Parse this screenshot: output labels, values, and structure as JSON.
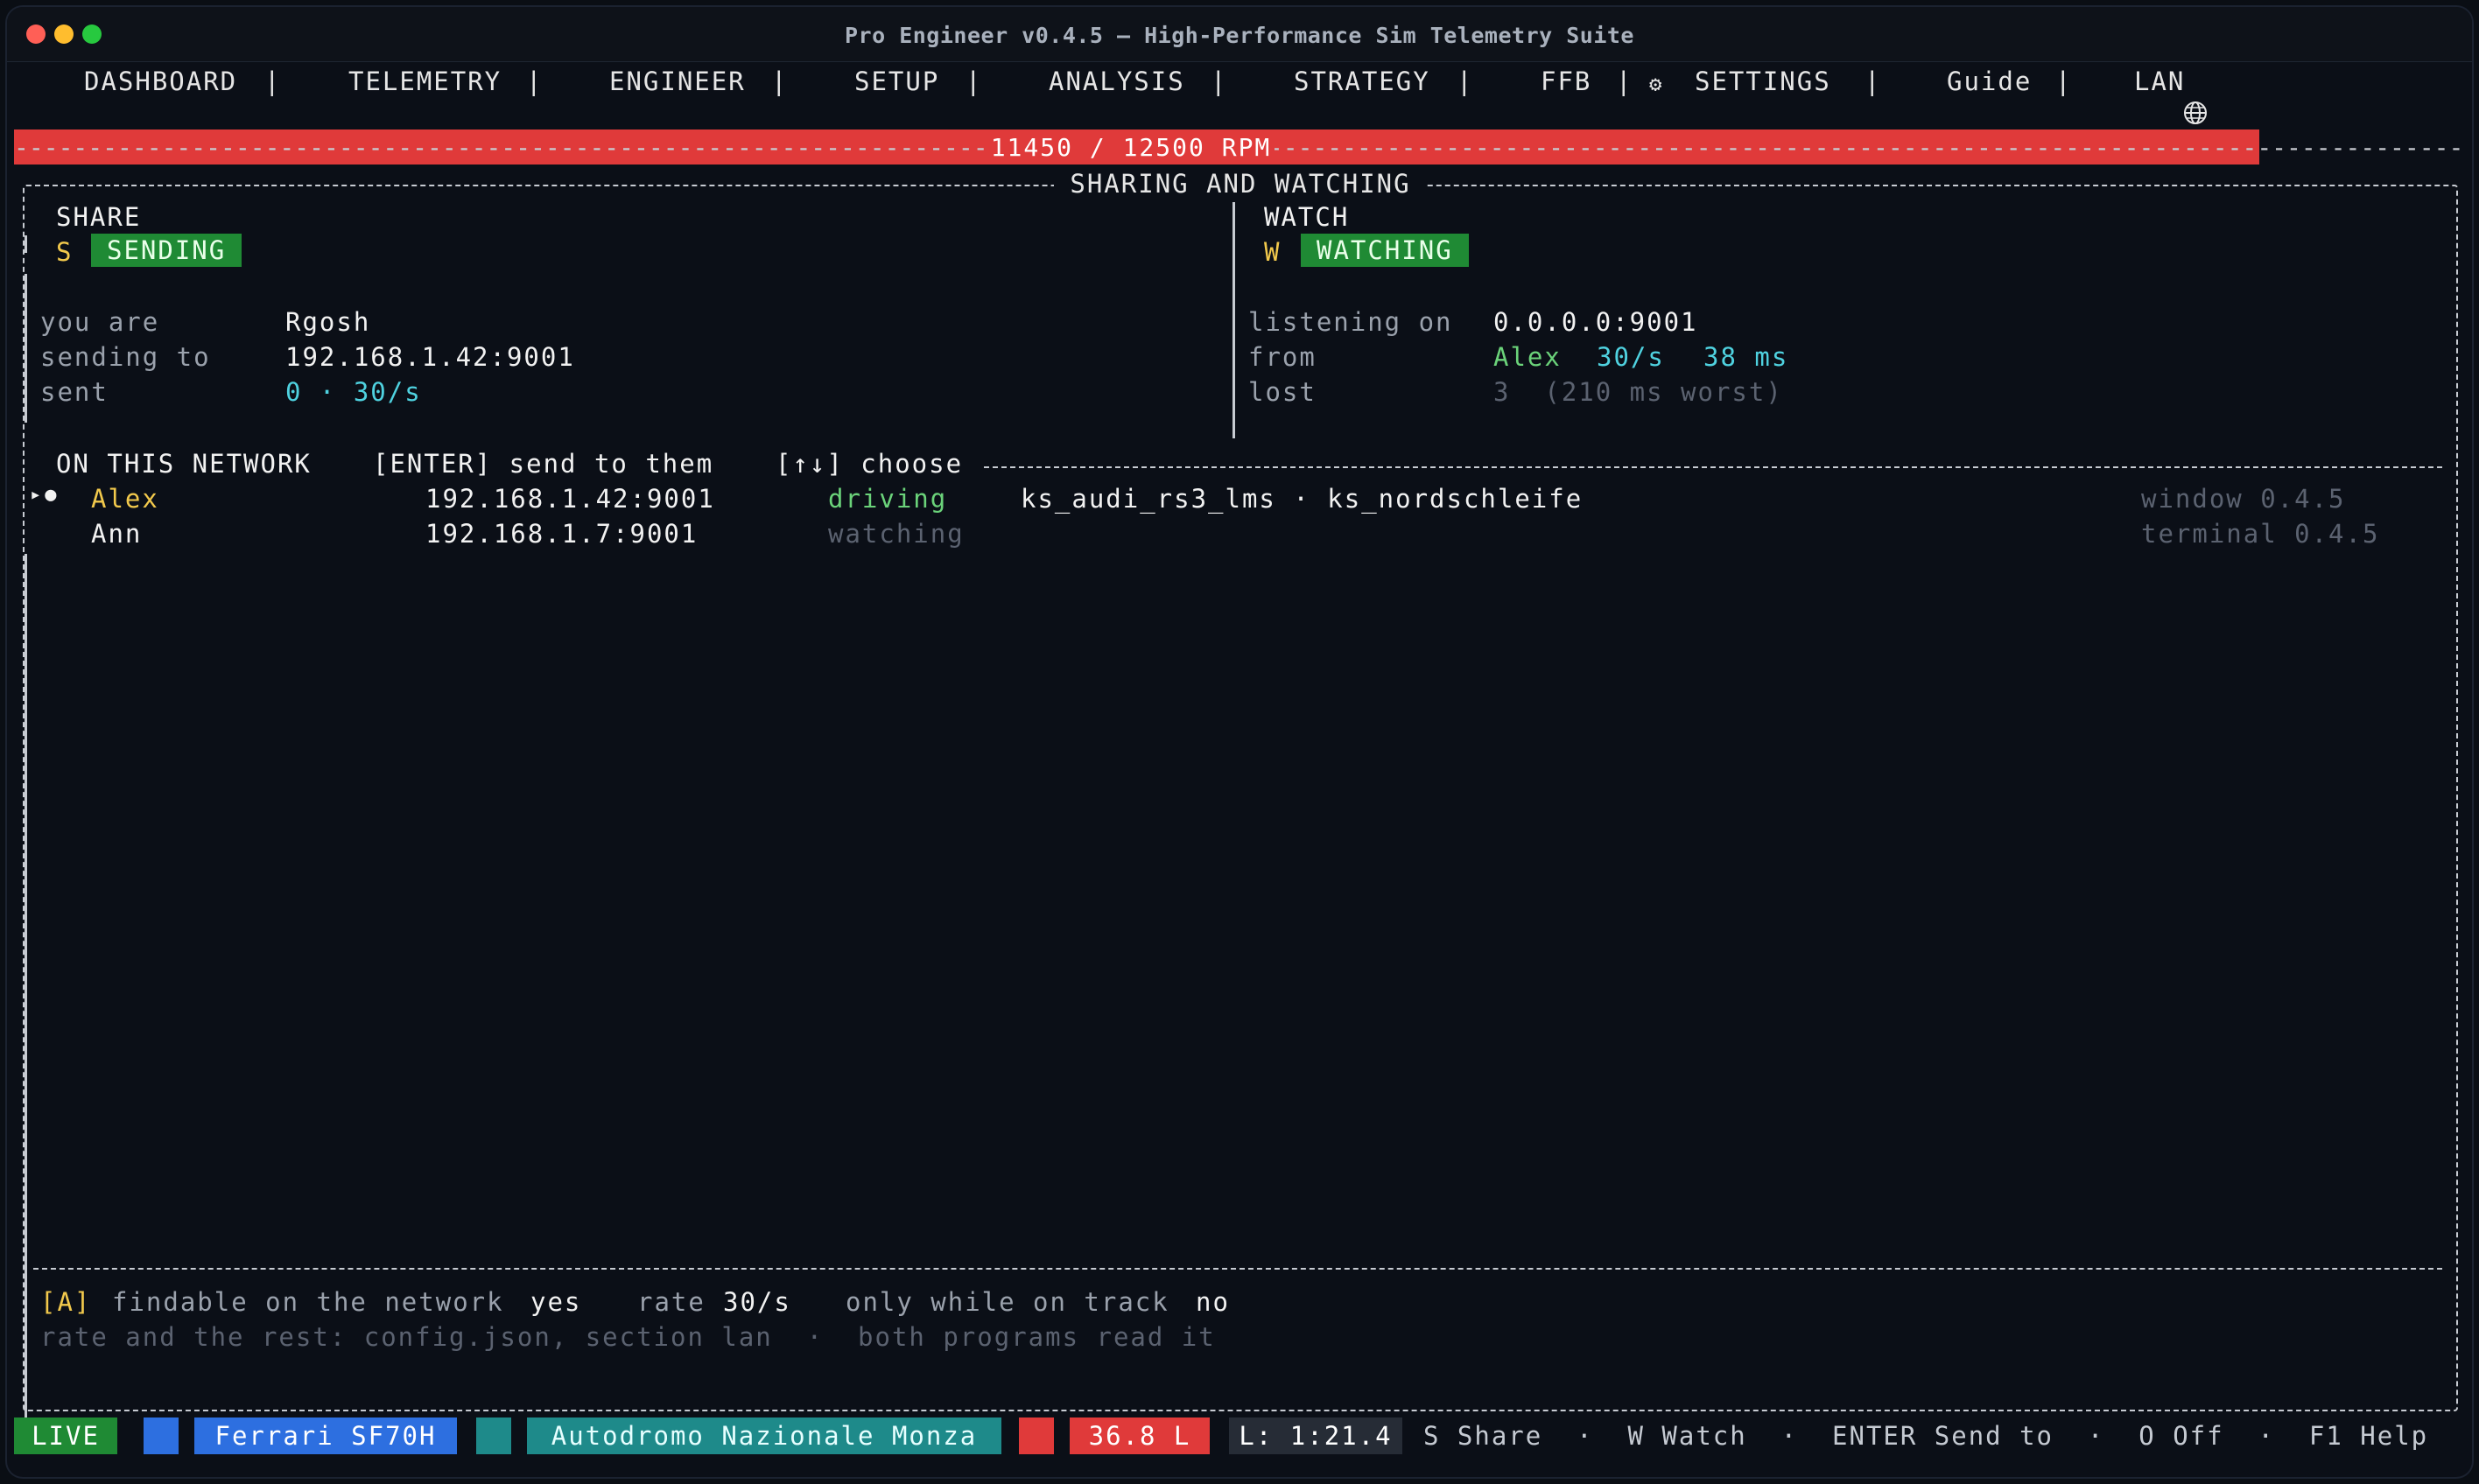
{
  "window": {
    "title": "Pro Engineer v0.4.5 — High-Performance Sim Telemetry Suite"
  },
  "nav": {
    "items": [
      "DASHBOARD",
      "TELEMETRY",
      "ENGINEER",
      "SETUP",
      "ANALYSIS",
      "STRATEGY",
      "FFB",
      "SETTINGS",
      "Guide",
      "LAN"
    ],
    "separator": "|",
    "settings_icon": "gear-icon",
    "lan_icon": "globe-icon"
  },
  "rpm": {
    "current": 11450,
    "max": 12500,
    "label": "11450 / 12500 RPM",
    "fill_fraction": 0.916,
    "color": "#e03a3a"
  },
  "panel": {
    "title": "SHARING AND WATCHING",
    "share": {
      "header": "SHARE",
      "key": "S",
      "status": "SENDING",
      "rows": [
        {
          "label": "you are",
          "value": "Rgosh"
        },
        {
          "label": "sending to",
          "value": "192.168.1.42:9001"
        },
        {
          "label": "sent",
          "value": "0 · 30/s"
        }
      ]
    },
    "watch": {
      "header": "WATCH",
      "key": "W",
      "status": "WATCHING",
      "listening_label": "listening on",
      "listening_value": "0.0.0.0:9001",
      "from_label": "from",
      "from_name": "Alex",
      "from_rate": "30/s",
      "from_latency": "38 ms",
      "lost_label": "lost",
      "lost_value": "3  (210 ms worst)"
    },
    "network": {
      "title": "ON THIS NETWORK",
      "hint_enter": "[ENTER] send to them",
      "hint_choose": "[↑↓] choose",
      "peers": [
        {
          "marker": "▸●",
          "name": "Alex",
          "address": "192.168.1.42:9001",
          "state": "driving",
          "session": "ks_audi_rs3_lms · ks_nordschleife",
          "client": "window 0.4.5"
        },
        {
          "marker": "",
          "name": "Ann",
          "address": "192.168.1.7:9001",
          "state": "watching",
          "session": "",
          "client": "terminal 0.4.5"
        }
      ]
    },
    "footer": {
      "key": "[A]",
      "findable_label": "findable on the network",
      "findable_value": "yes",
      "rate_label": "rate",
      "rate_value": "30/s",
      "only_label": "only while on track",
      "only_value": "no",
      "note": "rate and the rest: config.json, section lan  ·  both programs read it"
    }
  },
  "status": {
    "live": "LIVE",
    "car": "Ferrari SF70H",
    "track": "Autodromo Nazionale Monza",
    "fuel": "36.8 L",
    "lap": "L: 1:21.4",
    "hints": "S Share  ·  W Watch  ·  ENTER Send to  ·  O Off  ·  F1 Help"
  }
}
